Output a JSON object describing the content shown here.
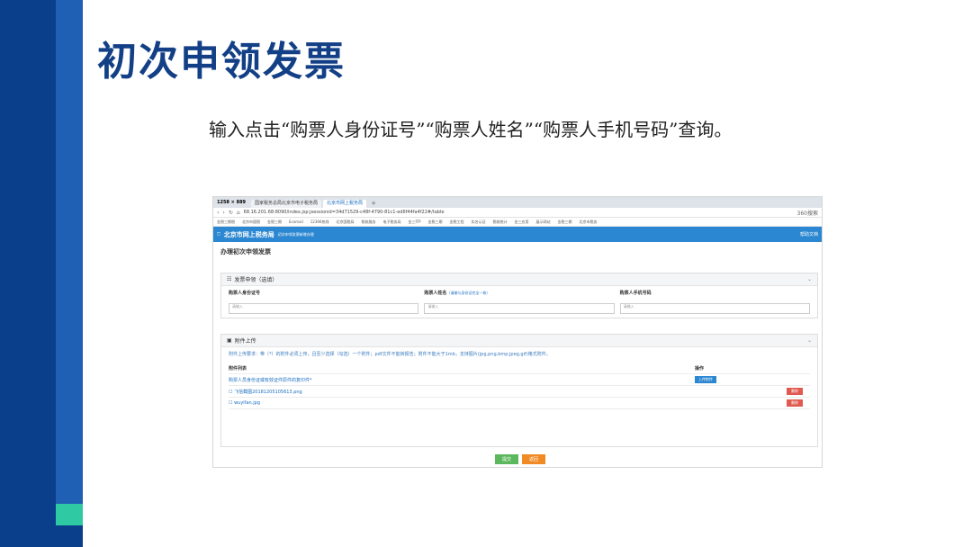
{
  "slide": {
    "title": "初次申领发票",
    "description": "输入点击“购票人身份证号”“购票人姓名”“购票人手机号码”查询。"
  },
  "browser": {
    "resolution_label": "1258 × 889",
    "tabs": [
      "国家税务总局北京市电子税务局",
      "北京市网上税务局"
    ],
    "new_tab": "+",
    "url": "68.16.201.68:8090/index.jsp;jsessionid=34d71529-c48f-4790-81c1-ed6f44fa4f22#/table",
    "nav": {
      "back": "‹",
      "forward": "›",
      "reload": "↻",
      "home": "⌂"
    },
    "search_placeholder": "360搜索",
    "bookmarks": [
      "金税三期税",
      "北京市国税",
      "金税三期",
      "Ecomail",
      "12366热线",
      "北京国税局",
      "税收服务",
      "电子税务局",
      "金三ITP",
      "金税三期",
      "金税工程",
      "实名认证",
      "税收统计",
      "金三应用",
      "展示网站",
      "金税三期",
      "北京市税务"
    ]
  },
  "site": {
    "name": "北京市网上税务局",
    "subtitle": "初次申领发票新增办理",
    "help": "帮助文档"
  },
  "page": {
    "title": "办理初次申领发票",
    "invoice_panel": {
      "header": "发票申领（选填）",
      "fields": [
        {
          "label": "购票人身份证号",
          "hint": "",
          "placeholder": "请输入"
        },
        {
          "label": "购票人姓名",
          "hint": "（请输与身份证完全一致）",
          "placeholder": "请输入"
        },
        {
          "label": "购票人手机号码",
          "hint": "",
          "placeholder": "请输入"
        }
      ]
    },
    "attachment_panel": {
      "header": "附件上传",
      "note": "附件上传要求：带（*）的附件必须上传，且至少选择（勾选）一个附件；pdf文件不能转报告；附件不能大于1mb，支持图片(jpg,png,bmp,jpeg,gif)格式附件。",
      "col_list": "附件列表",
      "col_op": "操作",
      "required_item": "购票人员身份证或有效证件原件的复印件*",
      "upload_button": "上传附件",
      "files": [
        {
          "name": "飞信截图20181205105613.png",
          "delete": "删除"
        },
        {
          "name": "wuyifan.jpg",
          "delete": "删除"
        }
      ]
    },
    "buttons": {
      "submit": "提交",
      "return": "返回"
    }
  },
  "colors": {
    "band_dark": "#0a3f8c",
    "band_mid": "#1f5fb4",
    "band_accent": "#2fc9a4",
    "title": "#123f86",
    "site_header": "#2b87d1",
    "submit": "#5cb85c",
    "return": "#f08a24",
    "delete": "#e05a4f"
  }
}
